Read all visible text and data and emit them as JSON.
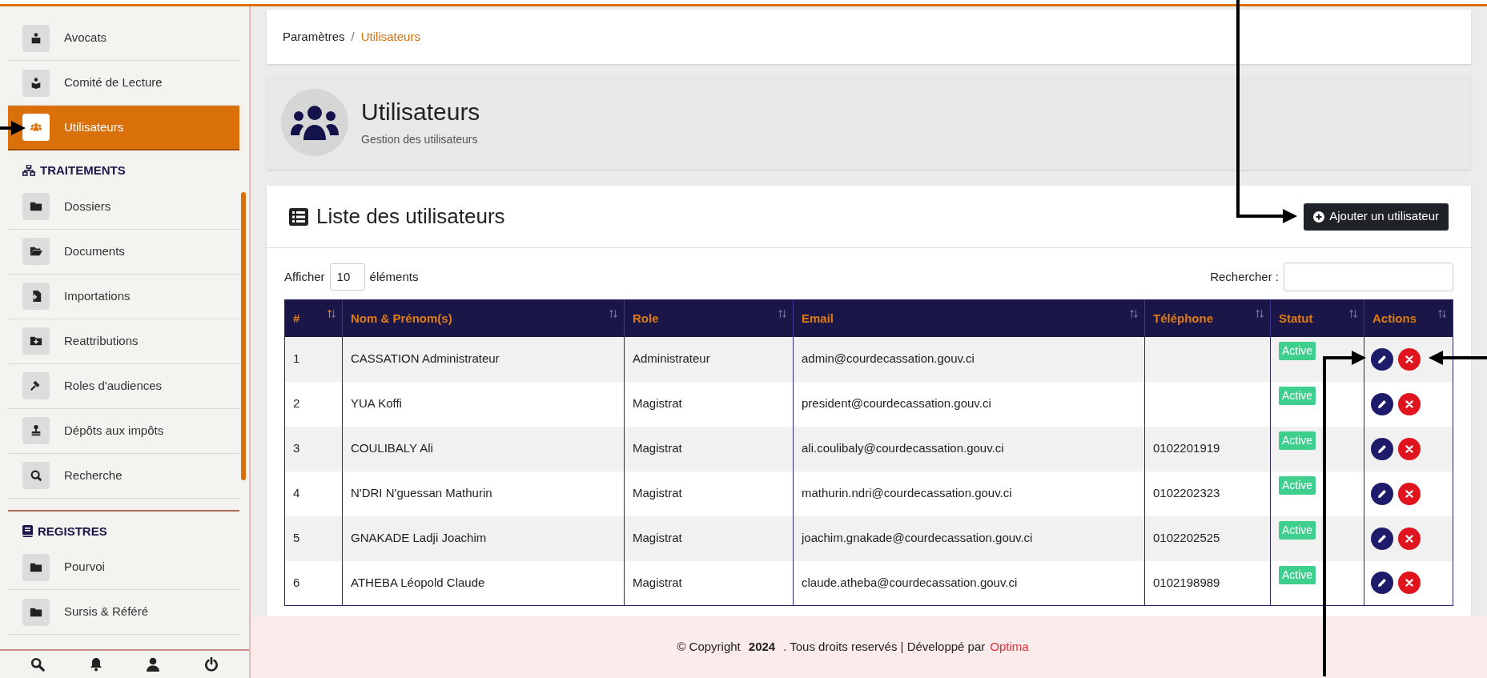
{
  "sidebar": {
    "sections": [
      {
        "items": [
          {
            "label": "Avocats",
            "selected": false
          },
          {
            "label": "Comité de Lecture",
            "selected": false
          },
          {
            "label": "Utilisateurs",
            "selected": true
          }
        ]
      },
      {
        "title": "TRAITEMENTS",
        "items": [
          {
            "label": "Dossiers",
            "selected": false
          },
          {
            "label": "Documents",
            "selected": false
          },
          {
            "label": "Importations",
            "selected": false
          },
          {
            "label": "Reattributions",
            "selected": false
          },
          {
            "label": "Roles d'audiences",
            "selected": false
          },
          {
            "label": "Dépôts aux impôts",
            "selected": false
          },
          {
            "label": "Recherche",
            "selected": false
          }
        ]
      },
      {
        "title": "REGISTRES",
        "items": [
          {
            "label": "Pourvoi",
            "selected": false
          },
          {
            "label": "Sursis & Référé",
            "selected": false
          }
        ]
      }
    ]
  },
  "breadcrumb": {
    "items": [
      {
        "label": "Paramètres",
        "current": false
      },
      {
        "label": "Utilisateurs",
        "current": true
      }
    ],
    "separator": "/"
  },
  "page_header": {
    "title": "Utilisateurs",
    "subtitle": "Gestion des utilisateurs"
  },
  "list_card": {
    "title": "Liste des utilisateurs",
    "add_button": "Ajouter un utilisateur",
    "show_label": "Afficher",
    "page_length": "10",
    "entries_label": "éléments",
    "search_label": "Rechercher :",
    "table": {
      "columns": [
        {
          "label": "#",
          "sorted": true
        },
        {
          "label": "Nom & Prénom(s)",
          "sorted": false
        },
        {
          "label": "Role",
          "sorted": false
        },
        {
          "label": "Email",
          "sorted": false
        },
        {
          "label": "Téléphone",
          "sorted": false
        },
        {
          "label": "Statut",
          "sorted": false
        },
        {
          "label": "Actions",
          "sorted": false
        }
      ],
      "rows": [
        {
          "number": "1",
          "name": "CASSATION Administrateur",
          "role": "Administrateur",
          "email": "admin@courdecassation.gouv.ci",
          "phone": "",
          "status": "Active"
        },
        {
          "number": "2",
          "name": "YUA Koffi",
          "role": "Magistrat",
          "email": "president@courdecassation.gouv.ci",
          "phone": "",
          "status": "Active"
        },
        {
          "number": "3",
          "name": "COULIBALY Ali",
          "role": "Magistrat",
          "email": "ali.coulibaly@courdecassation.gouv.ci",
          "phone": "0102201919",
          "status": "Active"
        },
        {
          "number": "4",
          "name": "N'DRI N'guessan Mathurin",
          "role": "Magistrat",
          "email": "mathurin.ndri@courdecassation.gouv.ci",
          "phone": "0102202323",
          "status": "Active"
        },
        {
          "number": "5",
          "name": "GNAKADE Ladji Joachim",
          "role": "Magistrat",
          "email": "joachim.gnakade@courdecassation.gouv.ci",
          "phone": "0102202525",
          "status": "Active"
        },
        {
          "number": "6",
          "name": "ATHEBA Léopold Claude",
          "role": "Magistrat",
          "email": "claude.atheba@courdecassation.gouv.ci",
          "phone": "0102198989",
          "status": "Active"
        }
      ]
    }
  },
  "footer": {
    "copyright": "© Copyright",
    "year": "2024",
    "rights": ". Tous droits reservés | Développé par",
    "brand": "Optima"
  }
}
